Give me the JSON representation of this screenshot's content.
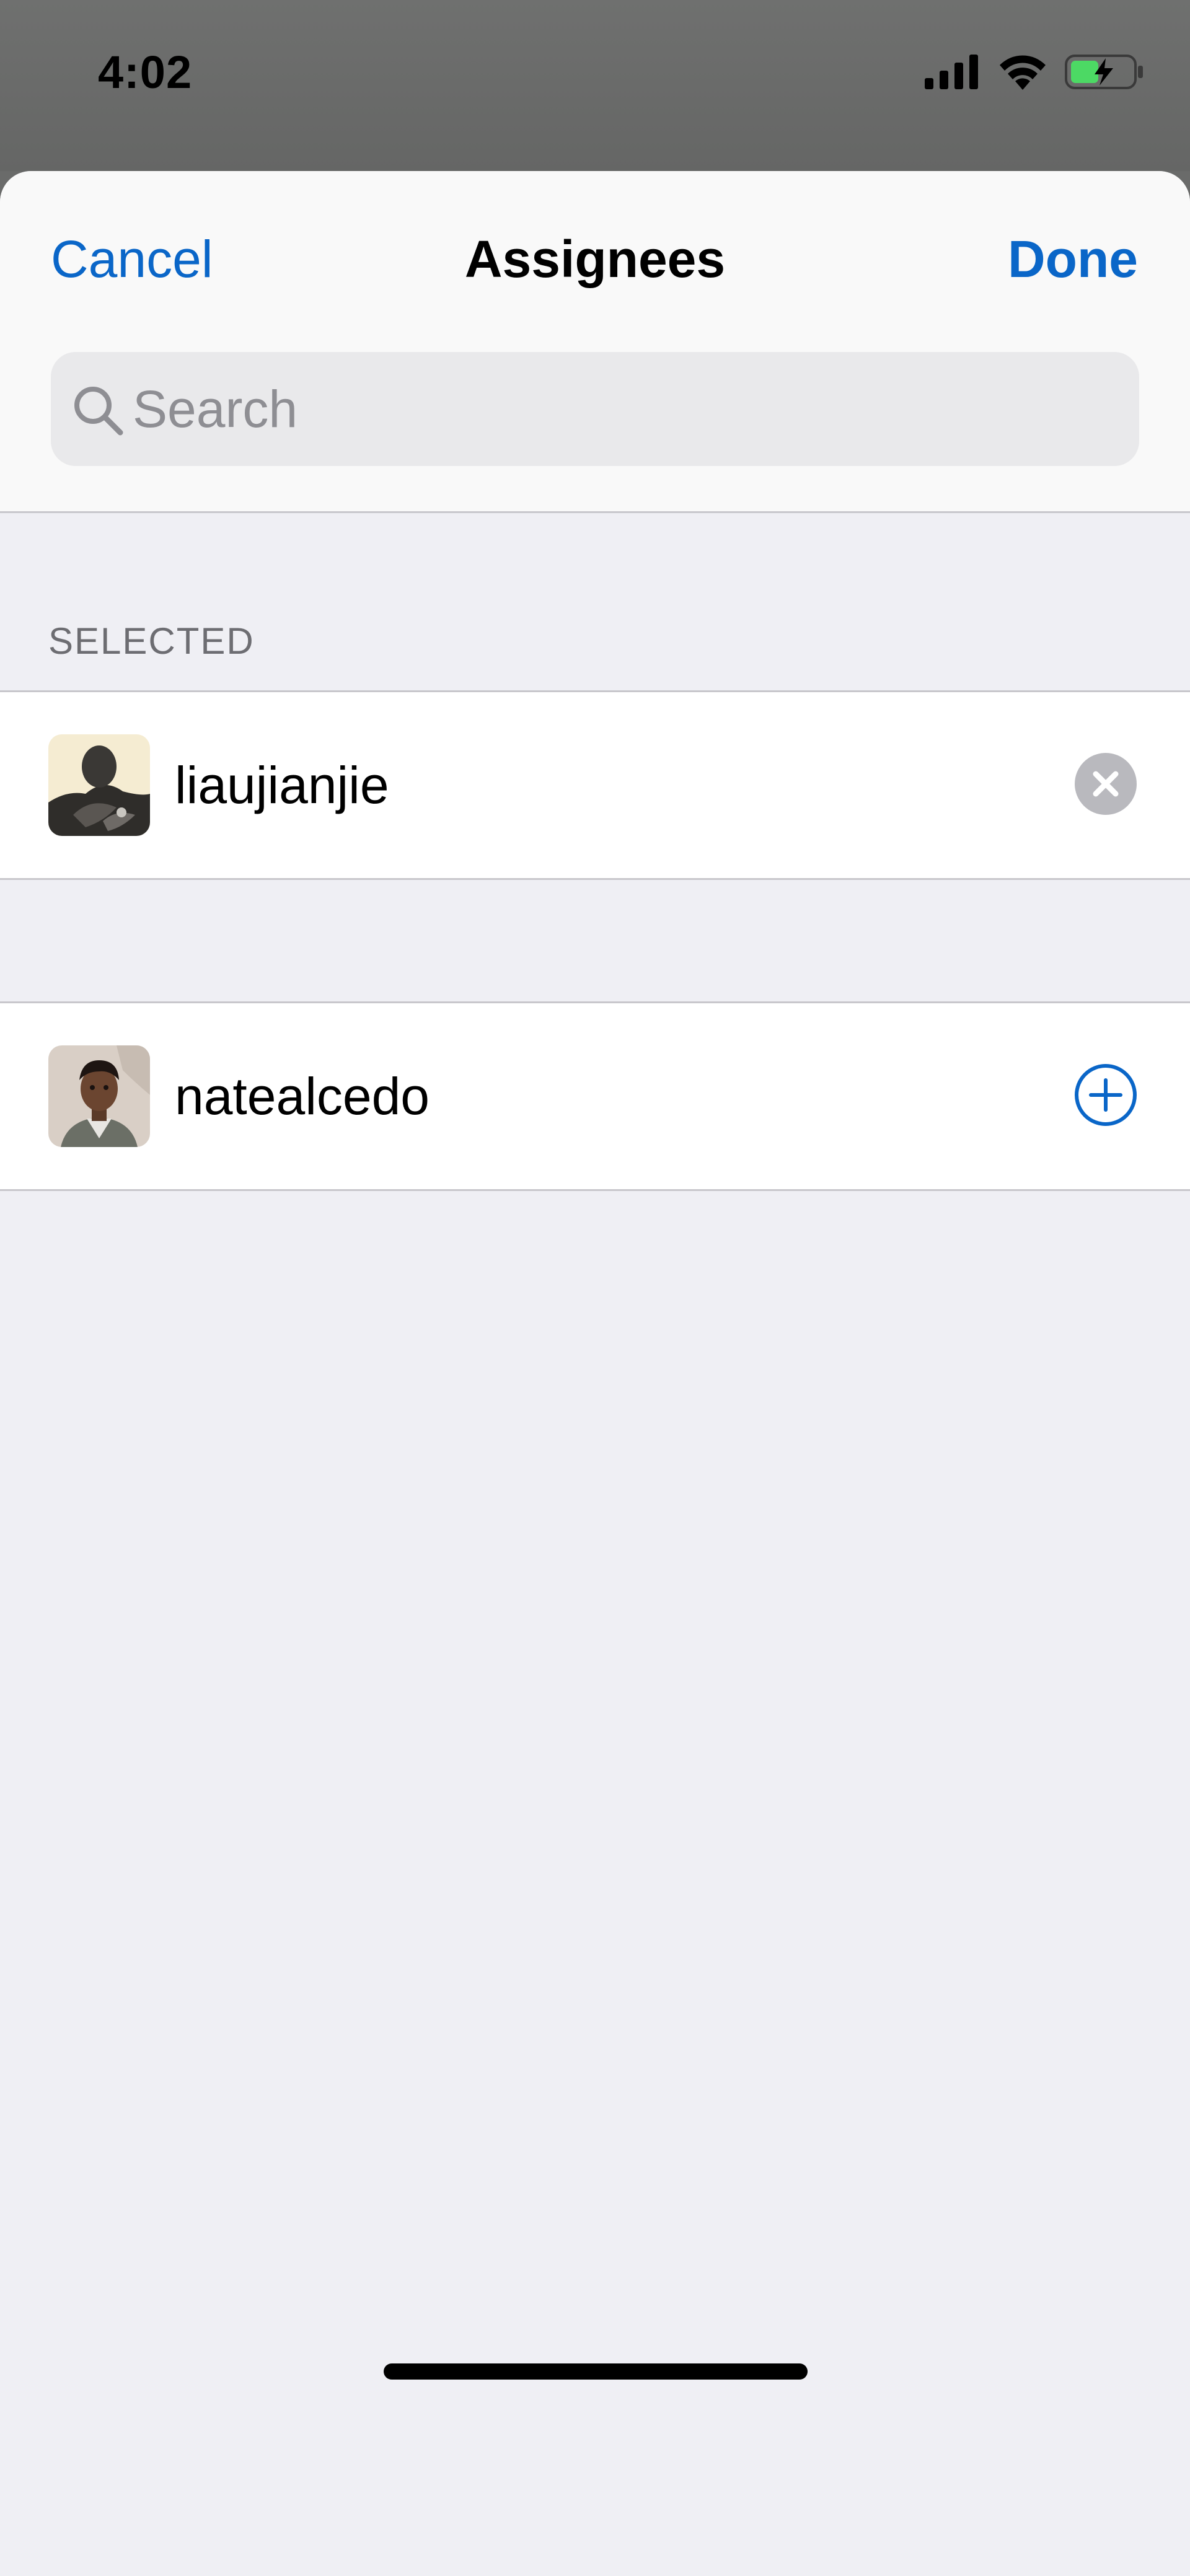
{
  "status_bar": {
    "time": "4:02",
    "icons": [
      "signal-icon",
      "wifi-icon",
      "battery-charging-icon"
    ],
    "battery_color": "#4cd964"
  },
  "nav": {
    "cancel_label": "Cancel",
    "title": "Assignees",
    "done_label": "Done"
  },
  "search": {
    "placeholder": "Search",
    "value": ""
  },
  "sections": {
    "selected_header": "SELECTED"
  },
  "selected_users": [
    {
      "username": "liaujianjie",
      "action_icon": "remove-circle-icon"
    }
  ],
  "available_users": [
    {
      "username": "natealcedo",
      "action_icon": "add-circle-icon"
    }
  ],
  "colors": {
    "accent": "#0a66c8",
    "background": "#efeff4",
    "separator": "#c8c7cc",
    "secondary_text": "#6d6d72"
  }
}
